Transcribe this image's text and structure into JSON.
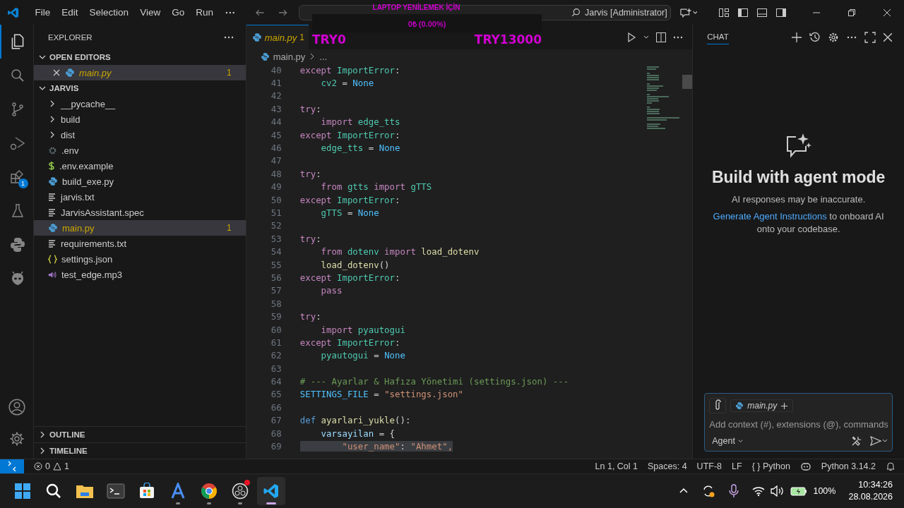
{
  "title_bar": {
    "menu": [
      "File",
      "Edit",
      "Selection",
      "View",
      "Go",
      "Run"
    ],
    "search_text": "Jarvis [Administrator]"
  },
  "overlay": {
    "title": "LAPTOP YENİLEMEK İÇİN",
    "amount": "0₺ (0.00%)",
    "start": "TRY0",
    "goal": "TRY13000",
    "level": 0
  },
  "activity_bar": {
    "items": [
      {
        "kind": "explorer",
        "selected": true
      },
      {
        "kind": "search",
        "selected": false
      },
      {
        "kind": "source-control",
        "selected": false
      },
      {
        "kind": "debug",
        "selected": false
      },
      {
        "kind": "extensions",
        "selected": false,
        "badge": "1"
      },
      {
        "kind": "testing",
        "selected": false
      },
      {
        "kind": "python",
        "selected": false
      },
      {
        "kind": "alien",
        "selected": false
      }
    ]
  },
  "sidebar": {
    "title": "EXPLORER",
    "open_editors": {
      "label": "OPEN EDITORS",
      "expanded": true,
      "items": [
        {
          "name": "main.py",
          "kind": "python",
          "warnings": "1",
          "selected": true
        }
      ]
    },
    "folder": {
      "label": "JARVIS",
      "expanded": true,
      "items": [
        {
          "name": "__pycache__",
          "kind": "folder",
          "expanded": false,
          "selected": false
        },
        {
          "name": "build",
          "kind": "folder",
          "expanded": false,
          "selected": false
        },
        {
          "name": "dist",
          "kind": "folder",
          "expanded": false,
          "selected": false
        },
        {
          "name": ".env",
          "kind": "gear",
          "selected": false
        },
        {
          "name": ".env.example",
          "kind": "dollar",
          "selected": false
        },
        {
          "name": "build_exe.py",
          "kind": "python",
          "selected": false
        },
        {
          "name": "jarvis.txt",
          "kind": "text",
          "selected": false
        },
        {
          "name": "JarvisAssistant.spec",
          "kind": "text",
          "selected": false
        },
        {
          "name": "main.py",
          "kind": "python",
          "selected": true,
          "warnings": "1"
        },
        {
          "name": "requirements.txt",
          "kind": "text",
          "selected": false
        },
        {
          "name": "settings.json",
          "kind": "json",
          "selected": false
        },
        {
          "name": "test_edge.mp3",
          "kind": "audio",
          "selected": false
        }
      ]
    },
    "bottom_sections": [
      {
        "label": "OUTLINE",
        "expanded": false
      },
      {
        "label": "TIMELINE",
        "expanded": false
      }
    ]
  },
  "editor": {
    "tab": {
      "name": "main.py",
      "warnings": "1"
    },
    "breadcrumb": [
      "main.py",
      "..."
    ],
    "lines": [
      {
        "n": "40",
        "tokens": [
          {
            "text": "except ",
            "kind": "keyword"
          },
          {
            "text": "ImportError",
            "kind": "type"
          },
          {
            "text": ":",
            "kind": "plain"
          }
        ]
      },
      {
        "n": "41",
        "tokens": [
          {
            "text": "    cv2",
            "kind": "type"
          },
          {
            "text": " = ",
            "kind": "plain"
          },
          {
            "text": "None",
            "kind": "constant"
          }
        ]
      },
      {
        "n": "42"
      },
      {
        "n": "43",
        "tokens": [
          {
            "text": "try",
            "kind": "keyword"
          },
          {
            "text": ":",
            "kind": "plain"
          }
        ]
      },
      {
        "n": "44",
        "tokens": [
          {
            "text": "    import ",
            "kind": "keyword"
          },
          {
            "text": "edge_tts",
            "kind": "type"
          }
        ]
      },
      {
        "n": "45",
        "tokens": [
          {
            "text": "except ",
            "kind": "keyword"
          },
          {
            "text": "ImportError",
            "kind": "type"
          },
          {
            "text": ":",
            "kind": "plain"
          }
        ]
      },
      {
        "n": "46",
        "tokens": [
          {
            "text": "    edge_tts",
            "kind": "type"
          },
          {
            "text": " = ",
            "kind": "plain"
          },
          {
            "text": "None",
            "kind": "constant"
          }
        ]
      },
      {
        "n": "47"
      },
      {
        "n": "48",
        "tokens": [
          {
            "text": "try",
            "kind": "keyword"
          },
          {
            "text": ":",
            "kind": "plain"
          }
        ]
      },
      {
        "n": "49",
        "tokens": [
          {
            "text": "    from ",
            "kind": "keyword"
          },
          {
            "text": "gtts",
            "kind": "type"
          },
          {
            "text": " import ",
            "kind": "keyword"
          },
          {
            "text": "gTTS",
            "kind": "type"
          }
        ]
      },
      {
        "n": "50",
        "tokens": [
          {
            "text": "except ",
            "kind": "keyword"
          },
          {
            "text": "ImportError",
            "kind": "type"
          },
          {
            "text": ":",
            "kind": "plain"
          }
        ]
      },
      {
        "n": "51",
        "tokens": [
          {
            "text": "    gTTS",
            "kind": "type"
          },
          {
            "text": " = ",
            "kind": "plain"
          },
          {
            "text": "None",
            "kind": "constant"
          }
        ]
      },
      {
        "n": "52"
      },
      {
        "n": "53",
        "tokens": [
          {
            "text": "try",
            "kind": "keyword"
          },
          {
            "text": ":",
            "kind": "plain"
          }
        ]
      },
      {
        "n": "54",
        "tokens": [
          {
            "text": "    from ",
            "kind": "keyword"
          },
          {
            "text": "dotenv",
            "kind": "type"
          },
          {
            "text": " import ",
            "kind": "keyword"
          },
          {
            "text": "load_dotenv",
            "kind": "function"
          }
        ]
      },
      {
        "n": "55",
        "tokens": [
          {
            "text": "    load_dotenv",
            "kind": "function"
          },
          {
            "text": "()",
            "kind": "plain"
          }
        ]
      },
      {
        "n": "56",
        "tokens": [
          {
            "text": "except ",
            "kind": "keyword"
          },
          {
            "text": "ImportError",
            "kind": "type"
          },
          {
            "text": ":",
            "kind": "plain"
          }
        ]
      },
      {
        "n": "57",
        "tokens": [
          {
            "text": "    pass",
            "kind": "keyword"
          }
        ]
      },
      {
        "n": "58"
      },
      {
        "n": "59",
        "tokens": [
          {
            "text": "try",
            "kind": "keyword"
          },
          {
            "text": ":",
            "kind": "plain"
          }
        ]
      },
      {
        "n": "60",
        "tokens": [
          {
            "text": "    import ",
            "kind": "keyword"
          },
          {
            "text": "pyautogui",
            "kind": "type"
          }
        ]
      },
      {
        "n": "61",
        "tokens": [
          {
            "text": "except ",
            "kind": "keyword"
          },
          {
            "text": "ImportError",
            "kind": "type"
          },
          {
            "text": ":",
            "kind": "plain"
          }
        ]
      },
      {
        "n": "62",
        "tokens": [
          {
            "text": "    pyautogui",
            "kind": "type"
          },
          {
            "text": " = ",
            "kind": "plain"
          },
          {
            "text": "None",
            "kind": "constant"
          }
        ]
      },
      {
        "n": "63"
      },
      {
        "n": "64",
        "tokens": [
          {
            "text": "# --- Ayarlar & Hafıza Yönetimi (settings.json) ---",
            "kind": "comment"
          }
        ]
      },
      {
        "n": "65",
        "tokens": [
          {
            "text": "SETTINGS_FILE",
            "kind": "constant"
          },
          {
            "text": " = ",
            "kind": "plain"
          },
          {
            "text": "\"settings.json\"",
            "kind": "string"
          }
        ]
      },
      {
        "n": "66"
      },
      {
        "n": "67",
        "tokens": [
          {
            "text": "def ",
            "kind": "storage"
          },
          {
            "text": "ayarlari_yukle",
            "kind": "function"
          },
          {
            "text": "():",
            "kind": "plain"
          }
        ]
      },
      {
        "n": "68",
        "tokens": [
          {
            "text": "    varsayilan",
            "kind": "variable"
          },
          {
            "text": " = {",
            "kind": "plain"
          }
        ]
      },
      {
        "n": "69",
        "highlighted": true,
        "tokens": [
          {
            "text": "        \"user_name\"",
            "kind": "string"
          },
          {
            "text": ": ",
            "kind": "plain"
          },
          {
            "text": "\"Ahmet\",",
            "kind": "string"
          }
        ]
      }
    ]
  },
  "chat": {
    "title": "CHAT",
    "heading": "Build with agent mode",
    "subtitle": "AI responses may be inaccurate.",
    "link": "Generate Agent Instructions",
    "link_rest": "to onboard AI onto your codebase.",
    "context_chip": "main.py",
    "placeholder": "Add context (#), extensions (@), commands",
    "mode": "Agent"
  },
  "status_bar": {
    "errors": "0",
    "warnings": "1",
    "items": [
      "Ln 1, Col 1",
      "Spaces: 4",
      "UTF-8",
      "LF",
      "{ } Python"
    ],
    "interpreter": "Python 3.14.2"
  },
  "taskbar": {
    "apps": [
      {
        "kind": "start",
        "running": false,
        "active": false
      },
      {
        "kind": "search",
        "running": false,
        "active": false
      },
      {
        "kind": "files",
        "running": false,
        "active": false
      },
      {
        "kind": "terminal",
        "running": false,
        "active": false
      },
      {
        "kind": "store",
        "running": false,
        "active": false
      },
      {
        "kind": "letter-a",
        "running": true,
        "active": false
      },
      {
        "kind": "chrome",
        "running": true,
        "active": false
      },
      {
        "kind": "obs",
        "running": true,
        "active": false,
        "notification": true
      },
      {
        "kind": "vscode",
        "running": true,
        "active": true
      }
    ],
    "battery": "100%",
    "time": "10:34:26",
    "date": "28.08.2026"
  }
}
